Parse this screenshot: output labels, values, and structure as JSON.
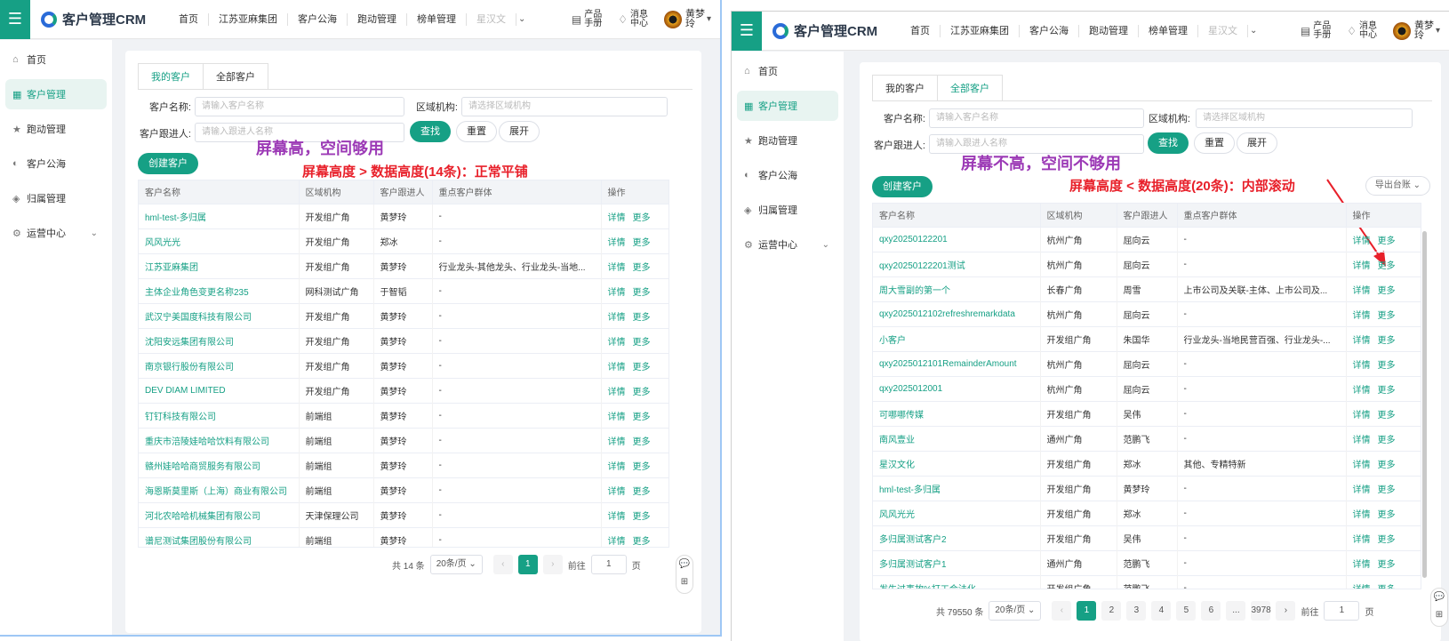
{
  "app": {
    "title": "客户管理CRM",
    "nav": [
      "首页",
      "江苏亚麻集团",
      "客户公海",
      "跑动管理",
      "榜单管理",
      "星汉文"
    ],
    "tools": {
      "manual": "产品手册",
      "messages": "消息中心"
    },
    "user": "黄梦玲"
  },
  "sidebar": {
    "items": [
      "首页",
      "客户管理",
      "跑动管理",
      "客户公海",
      "归属管理",
      "运营中心"
    ]
  },
  "colors": {
    "accent": "#16a085",
    "annotation_purple": "#9c3ab6",
    "annotation_red": "#e8202a"
  },
  "left": {
    "tabs": [
      "我的客户",
      "全部客户"
    ],
    "active_tab": 0,
    "filters": {
      "name_label": "客户名称:",
      "name_placeholder": "请输入客户名称",
      "region_label": "区域机构:",
      "region_placeholder": "请选择区域机构",
      "follower_label": "客户跟进人:",
      "follower_placeholder": "请输入跟进人名称",
      "search": "查找",
      "reset": "重置",
      "expand": "展开"
    },
    "create": "创建客户",
    "annotation_title": "屏幕高，空间够用",
    "annotation_sub": "屏幕高度 > 数据高度(14条)：正常平铺",
    "columns": [
      "客户名称",
      "区域机构",
      "客户跟进人",
      "重点客户群体",
      "操作"
    ],
    "ops": {
      "detail": "详情",
      "more": "更多"
    },
    "rows": [
      [
        "hml-test-多归属",
        "开发组广角",
        "黄梦玲",
        "-"
      ],
      [
        "风风光光",
        "开发组广角",
        "郑冰",
        "-"
      ],
      [
        "江苏亚麻集团",
        "开发组广角",
        "黄梦玲",
        "行业龙头-其他龙头、行业龙头-当地..."
      ],
      [
        "主体企业角色变更名称235",
        "网科测试广角",
        "于智韬",
        "-"
      ],
      [
        "武汉宁美国度科技有限公司",
        "开发组广角",
        "黄梦玲",
        "-"
      ],
      [
        "沈阳安远集团有限公司",
        "开发组广角",
        "黄梦玲",
        "-"
      ],
      [
        "南京银行股份有限公司",
        "开发组广角",
        "黄梦玲",
        "-"
      ],
      [
        "DEV DIAM LIMITED",
        "开发组广角",
        "黄梦玲",
        "-"
      ],
      [
        "钉钉科技有限公司",
        "前端组",
        "黄梦玲",
        "-"
      ],
      [
        "重庆市涪陵娃哈哈饮料有限公司",
        "前端组",
        "黄梦玲",
        "-"
      ],
      [
        "赣州娃哈哈商贸服务有限公司",
        "前端组",
        "黄梦玲",
        "-"
      ],
      [
        "海恩斯莫里斯（上海）商业有限公司",
        "前端组",
        "黄梦玲",
        "-"
      ],
      [
        "河北农哈哈机械集团有限公司",
        "天津保理公司",
        "黄梦玲",
        "-"
      ],
      [
        "谱尼测试集团股份有限公司",
        "前端组",
        "黄梦玲",
        "-"
      ]
    ],
    "pager": {
      "total": "共 14 条",
      "size": "20条/页",
      "pages": [
        "1"
      ],
      "jump_label": "前往",
      "jump_value": "1",
      "page_unit": "页"
    }
  },
  "right": {
    "tabs": [
      "我的客户",
      "全部客户"
    ],
    "active_tab": 1,
    "filters": {
      "name_label": "客户名称:",
      "name_placeholder": "请输入客户名称",
      "region_label": "区域机构:",
      "region_placeholder": "请选择区域机构",
      "follower_label": "客户跟进人:",
      "follower_placeholder": "请输入跟进人名称",
      "search": "查找",
      "reset": "重置",
      "expand": "展开"
    },
    "create": "创建客户",
    "export": "导出台账",
    "annotation_title": "屏幕不高，空间不够用",
    "annotation_sub": "屏幕高度 < 数据高度(20条)：内部滚动",
    "columns": [
      "客户名称",
      "区域机构",
      "客户跟进人",
      "重点客户群体",
      "操作"
    ],
    "ops": {
      "detail": "详情",
      "more": "更多"
    },
    "rows": [
      [
        "qxy20250122201",
        "杭州广角",
        "屈向云",
        "-"
      ],
      [
        "qxy20250122201测试",
        "杭州广角",
        "屈向云",
        "-"
      ],
      [
        "周大雪副的第一个",
        "长春广角",
        "周雪",
        "上市公司及关联-主体、上市公司及..."
      ],
      [
        "qxy2025012102refreshremarkdata",
        "杭州广角",
        "屈向云",
        "-"
      ],
      [
        "小客户",
        "开发组广角",
        "朱国华",
        "行业龙头-当地民营百强、行业龙头-..."
      ],
      [
        "qxy2025012101RemainderAmount",
        "杭州广角",
        "屈向云",
        "-"
      ],
      [
        "qxy2025012001",
        "杭州广角",
        "屈向云",
        "-"
      ],
      [
        "可哪哪传媒",
        "开发组广角",
        "吴伟",
        "-"
      ],
      [
        "南风壹业",
        "通州广角",
        "范鹏飞",
        "-"
      ],
      [
        "星汉文化",
        "开发组广角",
        "郑冰",
        "其他、专精特新"
      ],
      [
        "hml-test-多归属",
        "开发组广角",
        "黄梦玲",
        "-"
      ],
      [
        "风风光光",
        "开发组广角",
        "郑冰",
        "-"
      ],
      [
        "多归属测试客户2",
        "开发组广角",
        "吴伟",
        "-"
      ],
      [
        "多归属测试客户1",
        "通州广角",
        "范鹏飞",
        "-"
      ],
      [
        "发生过事故%打工合法化",
        "开发组广角",
        "范鹏飞",
        "-"
      ]
    ],
    "pager": {
      "total": "共 79550 条",
      "size": "20条/页",
      "pages": [
        "1",
        "2",
        "3",
        "4",
        "5",
        "6",
        "...",
        "3978"
      ],
      "jump_label": "前往",
      "jump_value": "1",
      "page_unit": "页"
    }
  },
  "float_help": {
    "label": "帮助"
  }
}
